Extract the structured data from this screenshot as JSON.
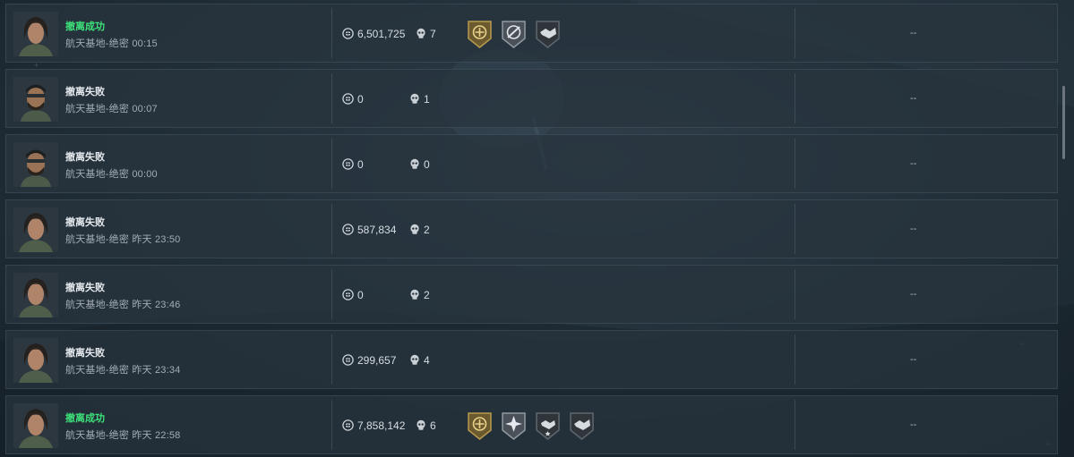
{
  "theme": {
    "success_color": "#3de27a",
    "fail_color": "#e6eaee",
    "badge_gold": "#b89a4e",
    "badge_grey": "#5e666d"
  },
  "records": [
    {
      "status": "撤离成功",
      "success": true,
      "subtitle": "航天基地-绝密 00:15",
      "money": "6,501,725",
      "kills": "7",
      "reward": "--",
      "avatar": "female-operator",
      "badges": [
        "gold-medal-badge",
        "rescue-badge",
        "handshake-badge"
      ]
    },
    {
      "status": "撤离失败",
      "success": false,
      "subtitle": "航天基地-绝密 00:07",
      "money": "0",
      "kills": "1",
      "reward": "--",
      "avatar": "male-operator",
      "badges": []
    },
    {
      "status": "撤离失败",
      "success": false,
      "subtitle": "航天基地-绝密 00:00",
      "money": "0",
      "kills": "0",
      "reward": "--",
      "avatar": "male-operator",
      "badges": []
    },
    {
      "status": "撤离失败",
      "success": false,
      "subtitle": "航天基地-绝密 昨天 23:50",
      "money": "587,834",
      "kills": "2",
      "reward": "--",
      "avatar": "female-operator",
      "badges": []
    },
    {
      "status": "撤离失败",
      "success": false,
      "subtitle": "航天基地-绝密 昨天 23:46",
      "money": "0",
      "kills": "2",
      "reward": "--",
      "avatar": "female-operator",
      "badges": []
    },
    {
      "status": "撤离失败",
      "success": false,
      "subtitle": "航天基地-绝密 昨天 23:34",
      "money": "299,657",
      "kills": "4",
      "reward": "--",
      "avatar": "female-operator",
      "badges": []
    },
    {
      "status": "撤离成功",
      "success": true,
      "subtitle": "航天基地-绝密 昨天 22:58",
      "money": "7,858,142",
      "kills": "6",
      "reward": "--",
      "avatar": "female-operator",
      "badges": [
        "gold-medal-badge",
        "star-burst-badge",
        "handshake-star-badge",
        "handshake-badge"
      ]
    }
  ]
}
